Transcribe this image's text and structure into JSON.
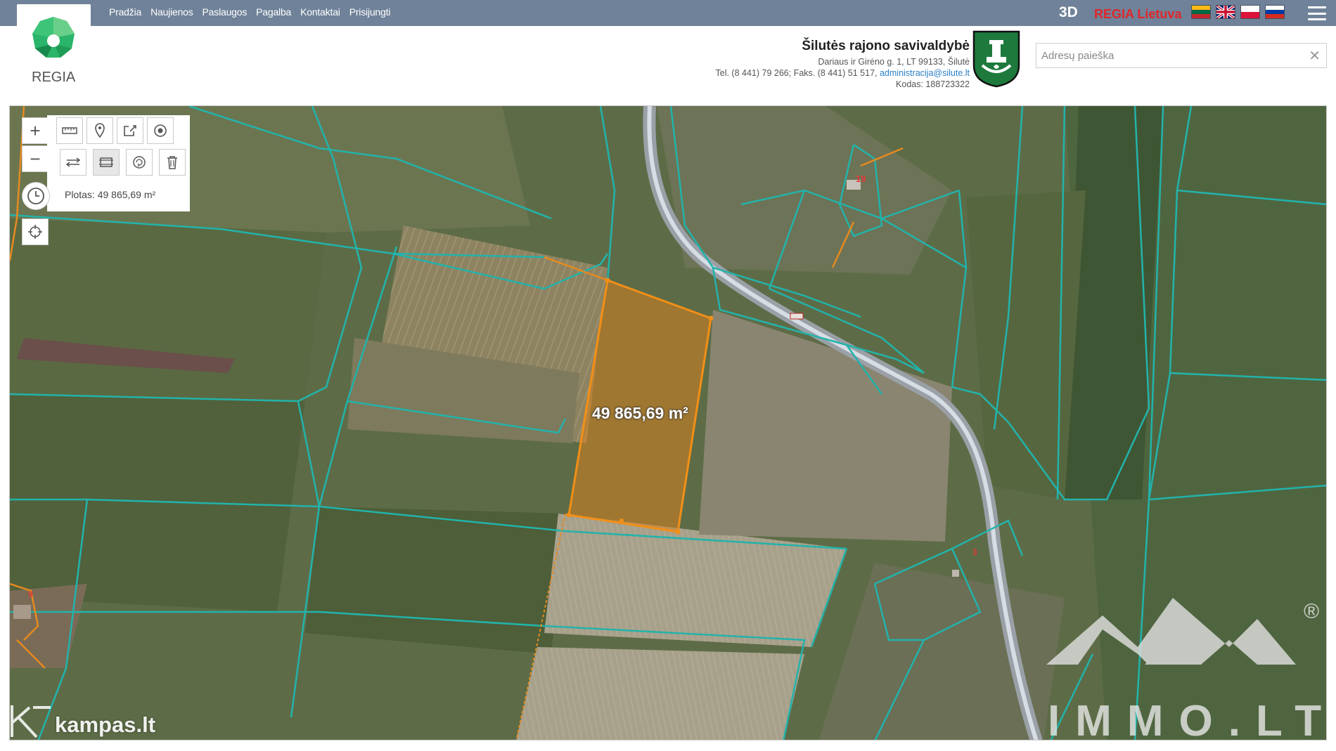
{
  "nav": {
    "items": [
      "Pradžia",
      "Naujienos",
      "Paslaugos",
      "Pagalba",
      "Kontaktai",
      "Prisijungti"
    ]
  },
  "topbar": {
    "btn_3d": "3D",
    "regia_lietuva": "REGIA Lietuva",
    "flags": [
      "lithuania-flag-icon",
      "uk-flag-icon",
      "poland-flag-icon",
      "russia-flag-icon"
    ],
    "colors": {
      "bar": "#6f8299",
      "regia_red": "#e0262a"
    }
  },
  "logo": {
    "text": "REGIA"
  },
  "municipality": {
    "name": "Šilutės rajono savivaldybė",
    "address": "Dariaus ir Girėno g. 1, LT 99133, Šilutė",
    "phone": "Tel. (8 441) 79 266; Faks. (8 441) 51 517,",
    "email": "administracija@silute.lt",
    "code": "Kodas: 188723322"
  },
  "search": {
    "placeholder": "Adresų paieška",
    "value": ""
  },
  "toolbar": {
    "zoom_in": "+",
    "zoom_out": "−",
    "icons": [
      "measure-distance-icon",
      "place-marker-icon",
      "share-icon",
      "target-icon",
      "distance-icon",
      "area-measure-icon",
      "clear-measure-icon",
      "trash-icon",
      "history-icon",
      "locate-icon"
    ]
  },
  "measurement": {
    "area_readout": "Plotas: 49 865,69 m²",
    "area_label": "49 865,69 m²",
    "parcel_color": "#e68a1e"
  },
  "map": {
    "parcel_numbers": [
      "19",
      "9",
      "3"
    ]
  },
  "watermark": {
    "kampas": "kampas.lt",
    "immo": "IMMO.LT",
    "registered": "®"
  }
}
